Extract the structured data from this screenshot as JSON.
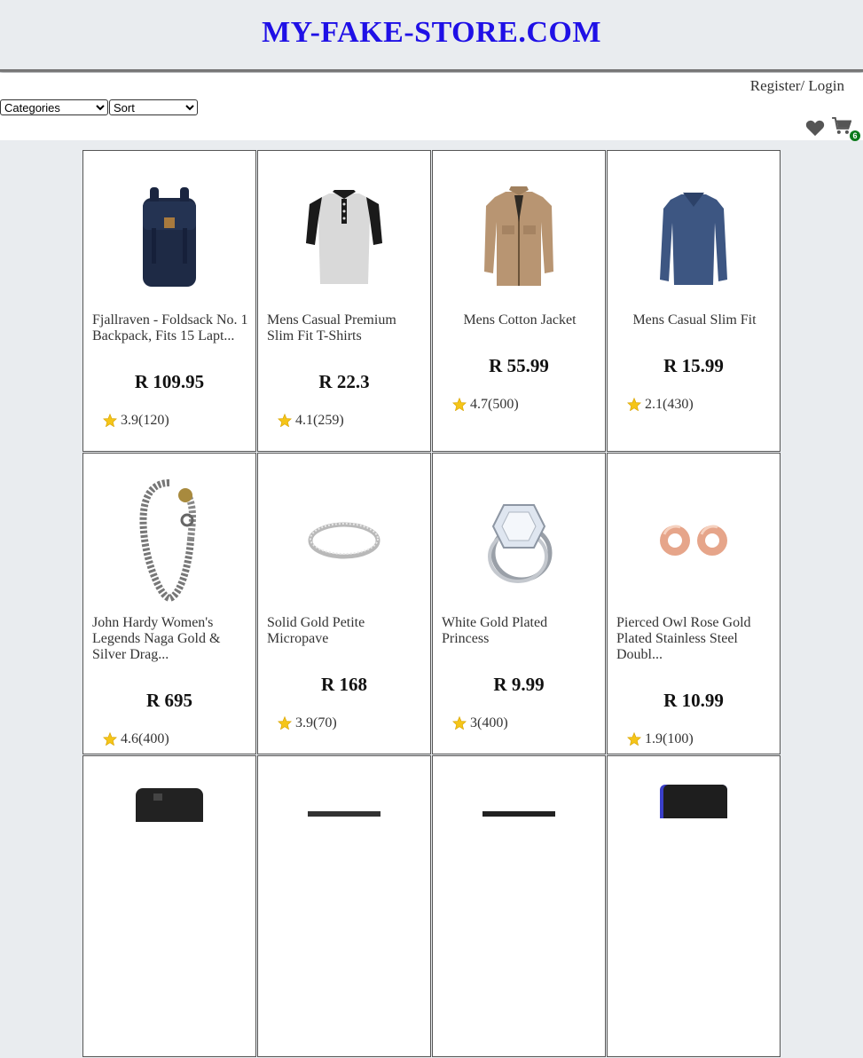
{
  "site": {
    "logo": "MY-FAKE-STORE.COM"
  },
  "auth": {
    "register": "Register",
    "separator": "/",
    "login": "Login"
  },
  "filters": {
    "categories": "Categories",
    "sort": "Sort"
  },
  "cart": {
    "count": "6"
  },
  "colors": {
    "logo": "#1f10e6",
    "badge": "#0b7a1a",
    "star": "#f5c518"
  },
  "products": [
    {
      "title": "Fjallraven - Foldsack No. 1 Backpack, Fits 15 Lapt...",
      "price": "R 109.95",
      "rating": "3.9(120)",
      "image_icon": "backpack-icon"
    },
    {
      "title": "Mens Casual Premium Slim Fit T-Shirts",
      "price": "R 22.3",
      "rating": "4.1(259)",
      "image_icon": "tshirt-icon"
    },
    {
      "title": "Mens Cotton Jacket",
      "price": "R 55.99",
      "rating": "4.7(500)",
      "image_icon": "jacket-icon"
    },
    {
      "title": "Mens Casual Slim Fit",
      "price": "R 15.99",
      "rating": "2.1(430)",
      "image_icon": "longsleeve-icon"
    },
    {
      "title": "John Hardy Women's Legends Naga Gold & Silver Drag...",
      "price": "R 695",
      "rating": "4.6(400)",
      "image_icon": "bracelet-icon"
    },
    {
      "title": "Solid Gold Petite Micropave",
      "price": "R 168",
      "rating": "3.9(70)",
      "image_icon": "ring-icon"
    },
    {
      "title": "White Gold Plated Princess",
      "price": "R 9.99",
      "rating": "3(400)",
      "image_icon": "diamond-ring-icon"
    },
    {
      "title": "Pierced Owl Rose Gold Plated Stainless Steel Doubl...",
      "price": "R 10.99",
      "rating": "1.9(100)",
      "image_icon": "earrings-icon"
    },
    {
      "image_icon": "hard-drive-icon"
    },
    {
      "image_icon": "ssd-icon"
    },
    {
      "image_icon": "ssd-icon"
    },
    {
      "image_icon": "portable-drive-icon"
    }
  ]
}
